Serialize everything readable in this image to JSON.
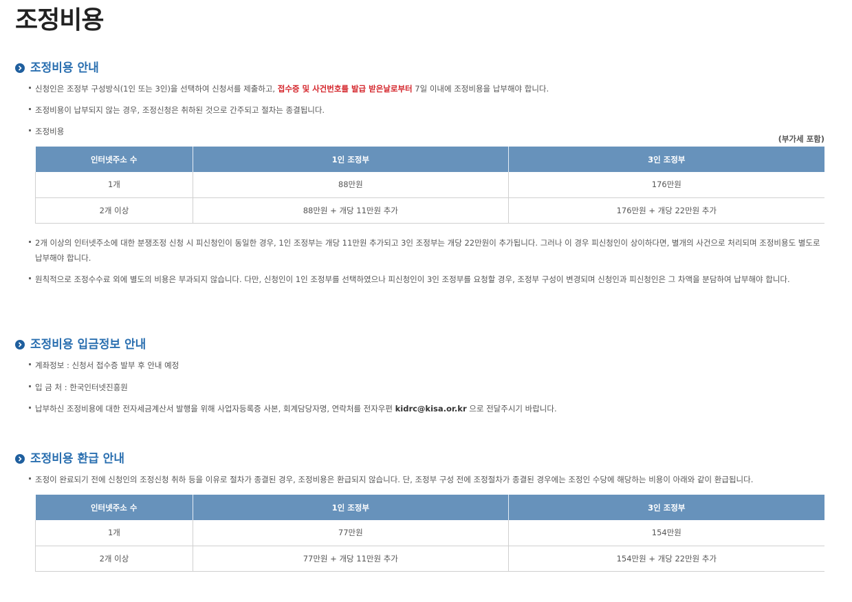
{
  "page_title": "조정비용",
  "section1": {
    "title": "조정비용 안내",
    "item1_pre": "신청인은 조정부 구성방식(1인 또는 3인)을 선택하여 신청서를 제출하고, ",
    "item1_highlight": "접수증 및 사건번호를 발급 받은날로부터",
    "item1_post": " 7일 이내에 조정비용을 납부해야 합니다.",
    "item2": "조정비용이 납부되지 않는 경우, 조정신청은 취하된 것으로 간주되고 절차는 종결됩니다.",
    "item3": "조정비용",
    "vat_note": "(부가세 포함)",
    "table": {
      "headers": [
        "인터넷주소 수",
        "1인 조정부",
        "3인 조정부"
      ],
      "rows": [
        [
          "1개",
          "88만원",
          "176만원"
        ],
        [
          "2개 이상",
          "88만원 + 개당 11만원 추가",
          "176만원 + 개당 22만원 추가"
        ]
      ]
    },
    "note1": "2개 이상의 인터넷주소에 대한 분쟁조정 신청 시 피신청인이 동일한 경우, 1인 조정부는 개당 11만원 추가되고 3인 조정부는 개당 22만원이 추가됩니다. 그러나 이 경우 피신청인이 상이하다면, 별개의 사건으로 처리되며 조정비용도 별도로 납부해야 합니다.",
    "note2": "원칙적으로 조정수수료 외에 별도의 비용은 부과되지 않습니다. 다만, 신청인이 1인 조정부를 선택하였으나 피신청인이 3인 조정부를 요청할 경우, 조정부 구성이 변경되며 신청인과 피신청인은 그 차액을 분담하여 납부해야 합니다."
  },
  "section2": {
    "title": "조정비용 입금정보 안내",
    "item1": "계좌정보 : 신청서 접수증 발부 후 안내 예정",
    "item2": "입 금 처 : 한국인터넷진흥원",
    "item3_pre": "납부하신 조정비용에 대한 전자세금계산서 발행을 위해 사업자등록증 사본, 회계담당자명, 연락처를 전자우편 ",
    "item3_email": "kidrc@kisa.or.kr",
    "item3_post": " 으로 전달주시기 바랍니다."
  },
  "section3": {
    "title": "조정비용 환급 안내",
    "item1": "조정이 완료되기 전에 신청인의 조정신청 취하 등을 이유로 절차가 종결된 경우, 조정비용은 환급되지 않습니다. 단, 조정부 구성 전에 조정절차가 종결된 경우에는 조정인 수당에 해당하는 비용이 아래와 같이 환급됩니다.",
    "table": {
      "headers": [
        "인터넷주소 수",
        "1인 조정부",
        "3인 조정부"
      ],
      "rows": [
        [
          "1개",
          "77만원",
          "154만원"
        ],
        [
          "2개 이상",
          "77만원 + 개당 11만원 추가",
          "154만원 + 개당 22만원 추가"
        ]
      ]
    }
  },
  "colors": {
    "accent": "#2a6fb0",
    "table_header": "#6792bb",
    "highlight": "#d4252b"
  },
  "icons": {
    "section_bullet": "chevron-right-circle-icon"
  }
}
